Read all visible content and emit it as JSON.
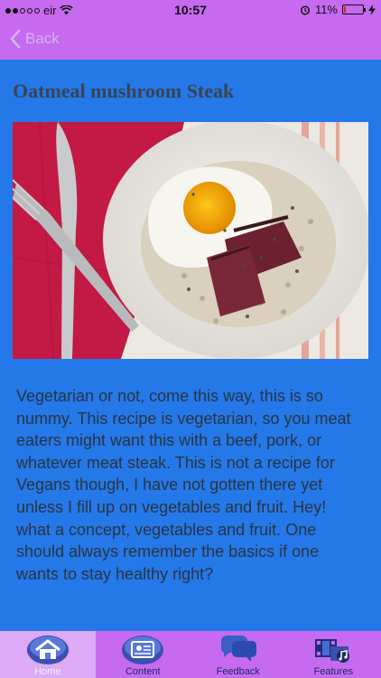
{
  "status_bar": {
    "carrier": "eir",
    "time": "10:57",
    "battery_percent": "11%",
    "battery_level": 0.11
  },
  "nav": {
    "back_label": "Back"
  },
  "main": {
    "title": "Oatmeal mushroom Steak",
    "body": "Vegetarian or not, come this way, this is so nummy. This recipe is vegetarian, so you meat eaters might want this with a beef, pork, or whatever meat steak. This is not a recipe for Vegans though, I have not gotten there yet unless I fill up on vegetables and fruit. Hey! what a concept, vegetables and fruit. One should always remember the basics if one wants to stay healthy right?"
  },
  "tabs": [
    {
      "label": "Home",
      "icon": "home-icon"
    },
    {
      "label": "Content",
      "icon": "content-icon"
    },
    {
      "label": "Feedback",
      "icon": "feedback-icon"
    },
    {
      "label": "Features",
      "icon": "features-icon"
    }
  ],
  "colors": {
    "bar": "#c66af0",
    "background": "#2478e8",
    "active_tab": "#dcaaf7"
  }
}
